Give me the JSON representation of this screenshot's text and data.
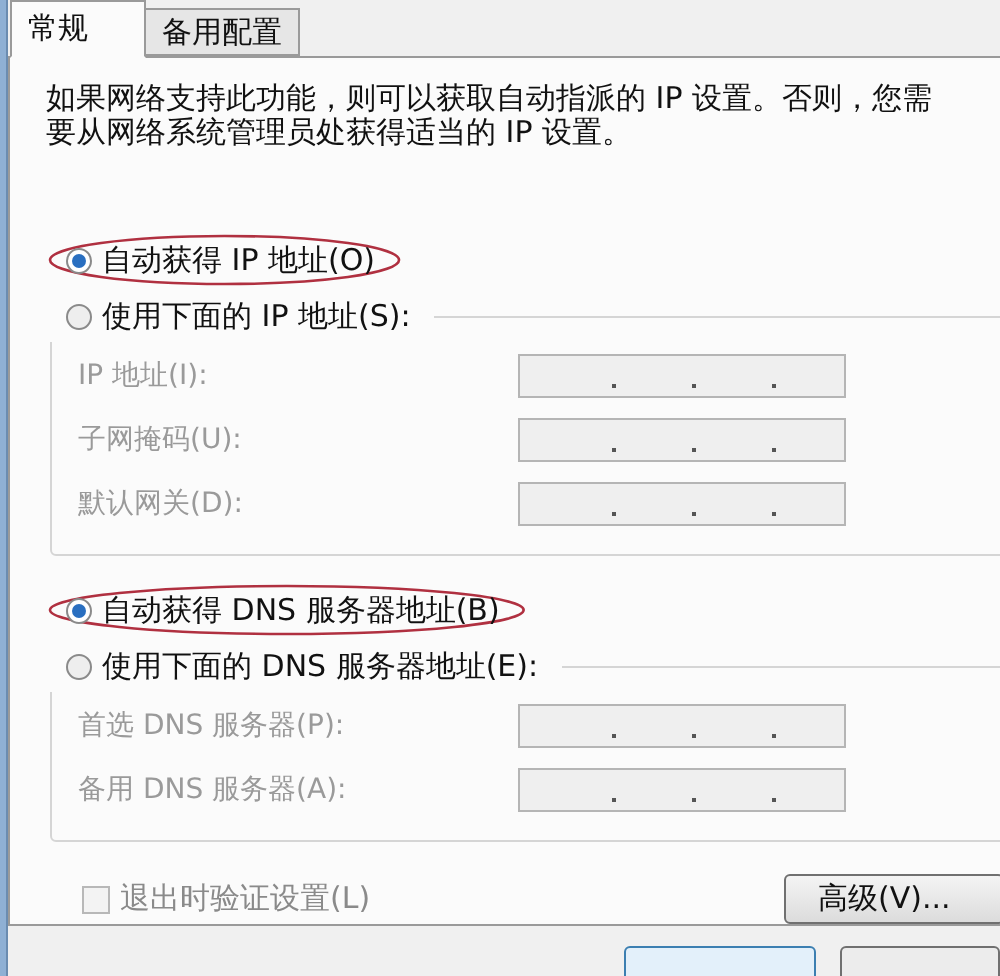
{
  "tabs": [
    {
      "label": "常规",
      "selected": true
    },
    {
      "label": "备用配置",
      "selected": false
    }
  ],
  "description": "如果网络支持此功能，则可以获取自动指派的 IP 设置。否则，您需要从网络系统管理员处获得适当的 IP 设置。",
  "ip_section": {
    "options": [
      {
        "label": "自动获得 IP 地址(O)",
        "selected": true,
        "highlighted": true
      },
      {
        "label": "使用下面的 IP 地址(S):",
        "selected": false,
        "highlighted": false
      }
    ],
    "fields": [
      {
        "label": "IP 地址(I):",
        "disabled": true
      },
      {
        "label": "子网掩码(U):",
        "disabled": true
      },
      {
        "label": "默认网关(D):",
        "disabled": true
      }
    ]
  },
  "dns_section": {
    "options": [
      {
        "label": "自动获得 DNS 服务器地址(B)",
        "selected": true,
        "highlighted": true
      },
      {
        "label": "使用下面的 DNS 服务器地址(E):",
        "selected": false,
        "highlighted": false
      }
    ],
    "fields": [
      {
        "label": "首选 DNS 服务器(P):",
        "disabled": true
      },
      {
        "label": "备用 DNS 服务器(A):",
        "disabled": true
      }
    ]
  },
  "validate_checkbox": {
    "label": "退出时验证设置(L)",
    "checked": false,
    "disabled": true
  },
  "advanced_button": {
    "label": "高级(V)..."
  }
}
